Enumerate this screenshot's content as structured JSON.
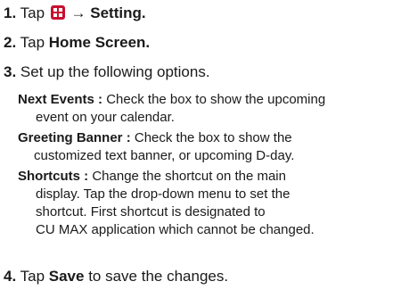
{
  "steps": [
    {
      "num": "1.",
      "pre": "Tap",
      "icon": "apps-grid-icon",
      "arrow": "→",
      "bold": "Setting."
    },
    {
      "num": "2.",
      "pre": "Tap",
      "bold": "Home Screen."
    },
    {
      "num": "3.",
      "text": "Set up the following options."
    },
    {
      "num": "4.",
      "pre": "Tap",
      "bold": "Save",
      "post": "to save the changes."
    }
  ],
  "options": [
    {
      "label": "Next Events :",
      "lines": [
        "Check the box to show the upcoming",
        "event on your calendar."
      ]
    },
    {
      "label": "Greeting Banner :",
      "lines": [
        "Check the box to show the",
        "customized text banner, or upcoming D-day."
      ]
    },
    {
      "label": "Shortcuts :",
      "lines": [
        "Change the shortcut on the main",
        "display. Tap the drop-down menu to set the",
        "shortcut. First shortcut is designated to",
        "CU MAX application which cannot be changed."
      ]
    }
  ],
  "colors": {
    "icon": "#c8102e",
    "text": "#1a1a1a"
  }
}
